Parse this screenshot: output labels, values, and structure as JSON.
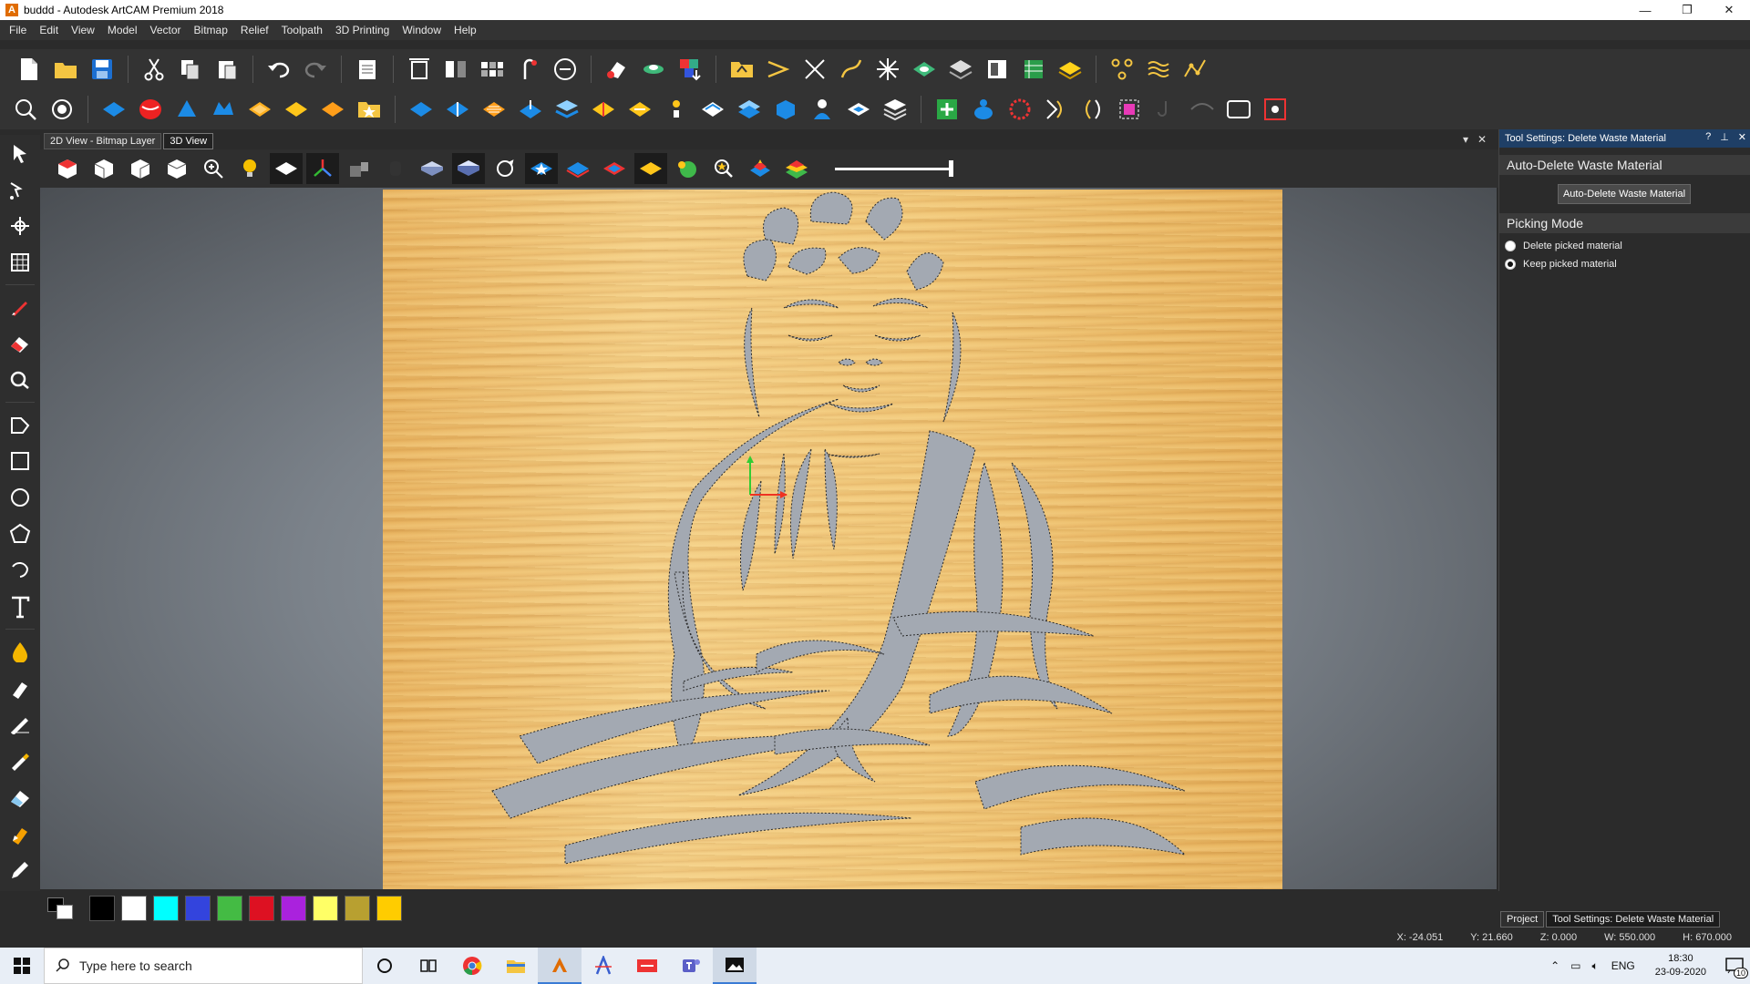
{
  "window": {
    "title": "buddd - Autodesk ArtCAM Premium 2018",
    "minimize": "—",
    "restore": "❐",
    "close": "✕"
  },
  "menu": [
    "File",
    "Edit",
    "View",
    "Model",
    "Vector",
    "Bitmap",
    "Relief",
    "Toolpath",
    "3D Printing",
    "Window",
    "Help"
  ],
  "view_tabs": {
    "tab_2d": "2D View - Bitmap Layer",
    "tab_3d": "3D View"
  },
  "panel": {
    "header": "Tool Settings: Delete Waste Material",
    "help": "?",
    "pin": "⊥",
    "close": "✕",
    "section1_title": "Auto-Delete Waste Material",
    "auto_delete_button": "Auto-Delete Waste Material",
    "section2_title": "Picking Mode",
    "radio_delete": "Delete picked material",
    "radio_keep": "Keep picked material",
    "radio_selected": "keep"
  },
  "bottom_tabs": {
    "project": "Project",
    "tool_settings": "Tool Settings: Delete Waste Material"
  },
  "palette": [
    "#000000",
    "#ffffff",
    "#00ffff",
    "#3344dd",
    "#44bb44",
    "#dd1122",
    "#aa22dd",
    "#ffff66",
    "#b8a030",
    "#ffcc00"
  ],
  "status": {
    "x": "X: -24.051",
    "y": "Y: 21.660",
    "z": "Z: 0.000",
    "w": "W: 550.000",
    "h": "H: 670.000"
  },
  "taskbar": {
    "search_placeholder": "Type here to search",
    "lang": "ENG",
    "time": "18:30",
    "date": "23-09-2020",
    "notifications": "10"
  }
}
